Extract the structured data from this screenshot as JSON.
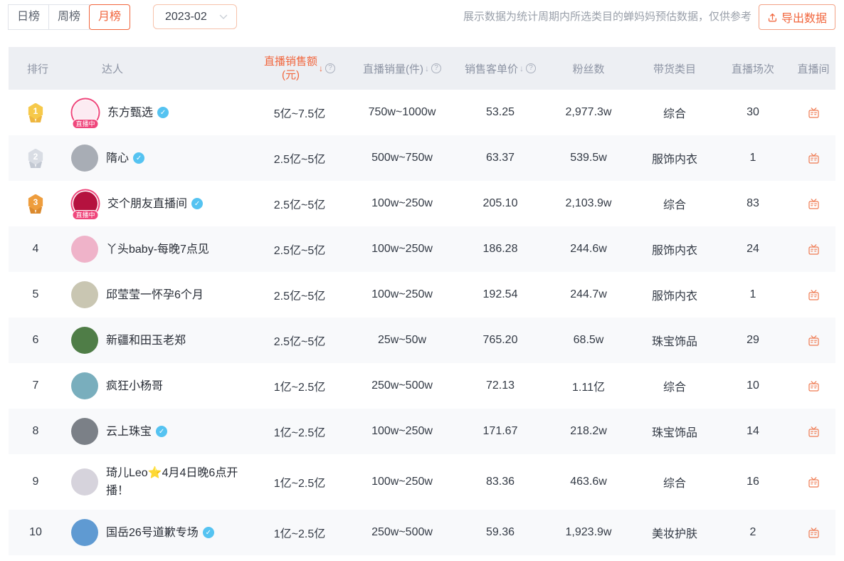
{
  "topbar": {
    "tabs": [
      {
        "label": "日榜",
        "tab_class": "tab"
      },
      {
        "label": "周榜",
        "tab_class": "tab"
      },
      {
        "label": "月榜",
        "tab_class": "tab active"
      }
    ],
    "date_select": {
      "value": "2023-02"
    },
    "note": "展示数据为统计周期内所选类目的蝉妈妈预估数据，仅供参考",
    "export_label": "导出数据"
  },
  "icons": {
    "sort_desc": "↓",
    "help": "?",
    "check": "✓"
  },
  "table": {
    "headers": {
      "rank": "排行",
      "talent": "达人",
      "sales_line1": "直播销售额",
      "sales_line2": "(元)",
      "volume": "直播销量(件)",
      "price": "销售客单价",
      "fans": "粉丝数",
      "category": "带货类目",
      "sessions": "直播场次",
      "liveroom": "直播间"
    },
    "live_badge": "直播中",
    "rows": [
      {
        "rank": "1",
        "is_medal": true,
        "is_plain": false,
        "medal_class": "rankmark gold",
        "name": "东方甄选",
        "verified": true,
        "live": true,
        "avatar_class": "avatar live",
        "avatar_style": "background:#fcebf2",
        "sales": "5亿~7.5亿",
        "volume": "750w~1000w",
        "price": "53.25",
        "fans": "2,977.3w",
        "category": "综合",
        "sessions": "30"
      },
      {
        "rank": "2",
        "is_medal": true,
        "is_plain": false,
        "medal_class": "rankmark silver",
        "name": "隋心",
        "verified": true,
        "live": false,
        "avatar_class": "avatar",
        "avatar_style": "background:#a8adb5",
        "sales": "2.5亿~5亿",
        "volume": "500w~750w",
        "price": "63.37",
        "fans": "539.5w",
        "category": "服饰内衣",
        "sessions": "1"
      },
      {
        "rank": "3",
        "is_medal": true,
        "is_plain": false,
        "medal_class": "rankmark bronze",
        "name": "交个朋友直播间",
        "verified": true,
        "live": true,
        "avatar_class": "avatar live",
        "avatar_style": "background:#b5123f",
        "sales": "2.5亿~5亿",
        "volume": "100w~250w",
        "price": "205.10",
        "fans": "2,103.9w",
        "category": "综合",
        "sessions": "83"
      },
      {
        "rank": "4",
        "is_medal": false,
        "is_plain": true,
        "medal_class": "rankmark",
        "name": "丫头baby-每晚7点见",
        "verified": false,
        "live": false,
        "avatar_class": "avatar",
        "avatar_style": "background:#efb3c9",
        "sales": "2.5亿~5亿",
        "volume": "100w~250w",
        "price": "186.28",
        "fans": "244.6w",
        "category": "服饰内衣",
        "sessions": "24"
      },
      {
        "rank": "5",
        "is_medal": false,
        "is_plain": true,
        "medal_class": "rankmark",
        "name": "邱莹莹一怀孕6个月",
        "verified": false,
        "live": false,
        "avatar_class": "avatar",
        "avatar_style": "background:#c9c6b2",
        "sales": "2.5亿~5亿",
        "volume": "100w~250w",
        "price": "192.54",
        "fans": "244.7w",
        "category": "服饰内衣",
        "sessions": "1"
      },
      {
        "rank": "6",
        "is_medal": false,
        "is_plain": true,
        "medal_class": "rankmark",
        "name": "新疆和田玉老郑",
        "verified": false,
        "live": false,
        "avatar_class": "avatar",
        "avatar_style": "background:#4f7d47",
        "sales": "2.5亿~5亿",
        "volume": "25w~50w",
        "price": "765.20",
        "fans": "68.5w",
        "category": "珠宝饰品",
        "sessions": "29"
      },
      {
        "rank": "7",
        "is_medal": false,
        "is_plain": true,
        "medal_class": "rankmark",
        "name": "疯狂小杨哥",
        "verified": false,
        "live": false,
        "avatar_class": "avatar",
        "avatar_style": "background:#79aebd",
        "sales": "1亿~2.5亿",
        "volume": "250w~500w",
        "price": "72.13",
        "fans": "1.11亿",
        "category": "综合",
        "sessions": "10"
      },
      {
        "rank": "8",
        "is_medal": false,
        "is_plain": true,
        "medal_class": "rankmark",
        "name": "云上珠宝",
        "verified": true,
        "live": false,
        "avatar_class": "avatar",
        "avatar_style": "background:#7b8087",
        "sales": "1亿~2.5亿",
        "volume": "100w~250w",
        "price": "171.67",
        "fans": "218.2w",
        "category": "珠宝饰品",
        "sessions": "14"
      },
      {
        "rank": "9",
        "is_medal": false,
        "is_plain": true,
        "medal_class": "rankmark",
        "name": "琦儿Leo⭐4月4日晚6点开播！",
        "verified": false,
        "live": false,
        "avatar_class": "avatar",
        "avatar_style": "background:#d6d3dc",
        "sales": "1亿~2.5亿",
        "volume": "100w~250w",
        "price": "83.36",
        "fans": "463.6w",
        "category": "综合",
        "sessions": "16"
      },
      {
        "rank": "10",
        "is_medal": false,
        "is_plain": true,
        "medal_class": "rankmark",
        "name": "国岳26号道歉专场",
        "verified": true,
        "live": false,
        "avatar_class": "avatar",
        "avatar_style": "background:#5f9ad2",
        "sales": "1亿~2.5亿",
        "volume": "250w~500w",
        "price": "59.36",
        "fans": "1,923.9w",
        "category": "美妆护肤",
        "sessions": "2"
      }
    ]
  },
  "colors": {
    "accent_orange": "#f1653c",
    "header_bg": "#edeff3",
    "header_text": "#8d94a4",
    "live_pink": "#ef477c",
    "verified_blue": "#55c3f1",
    "medal_gold": "#f6c94a",
    "medal_silver": "#d9dde4",
    "medal_bronze": "#ee9d3d",
    "alt_row_bg": "#f8f9fb"
  }
}
